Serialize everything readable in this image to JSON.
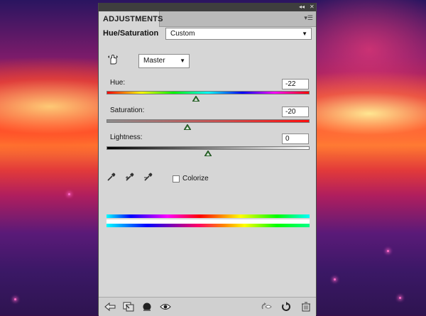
{
  "panel": {
    "tab_label": "ADJUSTMENTS",
    "title": "Hue/Saturation",
    "preset_value": "Custom",
    "channel_value": "Master"
  },
  "sliders": {
    "hue": {
      "label": "Hue:",
      "value": "-22",
      "min": -180,
      "max": 180
    },
    "saturation": {
      "label": "Saturation:",
      "value": "-20",
      "min": -100,
      "max": 100
    },
    "lightness": {
      "label": "Lightness:",
      "value": "0",
      "min": -100,
      "max": 100
    }
  },
  "colorize": {
    "label": "Colorize",
    "checked": false
  },
  "icons": {
    "titlebar": [
      "collapse-icon",
      "close-icon"
    ],
    "panel_menu": "panel-menu-icon",
    "targeted_adjustment": "hand-adjust-icon",
    "eyedroppers": [
      "eyedropper-icon",
      "eyedropper-plus-icon",
      "eyedropper-minus-icon"
    ],
    "footer": [
      "back-arrow-icon",
      "clip-to-layer-icon",
      "visibility-mask-icon",
      "eye-icon",
      "view-previous-icon",
      "reset-icon",
      "trash-icon"
    ]
  },
  "colors": {
    "panel_bg": "#d6d6d6",
    "titlebar_bg": "#3e3e3e",
    "thumb_fill": "#2f7a2f"
  }
}
